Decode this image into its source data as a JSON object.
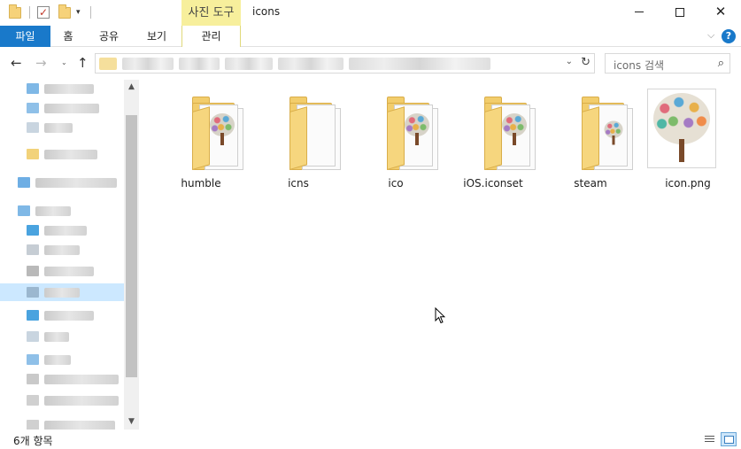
{
  "window": {
    "title": "icons",
    "context_tab": "사진 도구",
    "minimize": "—",
    "maximize": "☐",
    "close": "✕"
  },
  "ribbon": {
    "tabs": [
      {
        "label": "파일"
      },
      {
        "label": "홈"
      },
      {
        "label": "공유"
      },
      {
        "label": "보기"
      },
      {
        "label": "관리"
      }
    ],
    "collapse_glyph": "⌵",
    "help_glyph": "?"
  },
  "nav": {
    "back_glyph": "←",
    "forward_glyph": "→",
    "up_glyph": "↑",
    "recent_glyph": "⌄",
    "address_dropdown_glyph": "⌄",
    "refresh_glyph": "↻"
  },
  "search": {
    "placeholder": "icons 검색",
    "icon_glyph": "⌕"
  },
  "files": [
    {
      "name": "humble",
      "type": "folder",
      "preview": "tree"
    },
    {
      "name": "icns",
      "type": "folder",
      "preview": "pages"
    },
    {
      "name": "ico",
      "type": "folder",
      "preview": "tree"
    },
    {
      "name": "iOS.iconset",
      "type": "folder",
      "preview": "tree"
    },
    {
      "name": "steam",
      "type": "folder",
      "preview": "tree-small"
    },
    {
      "name": "icon.png",
      "type": "image",
      "preview": "tree-large"
    }
  ],
  "status": {
    "item_count": "6개 항목"
  },
  "scroll": {
    "up_glyph": "▲",
    "down_glyph": "▼"
  },
  "colors": {
    "accent": "#1979ca",
    "context_tab": "#f7ef9c",
    "folder": "#f2cd6c",
    "selection": "#cce8ff"
  }
}
